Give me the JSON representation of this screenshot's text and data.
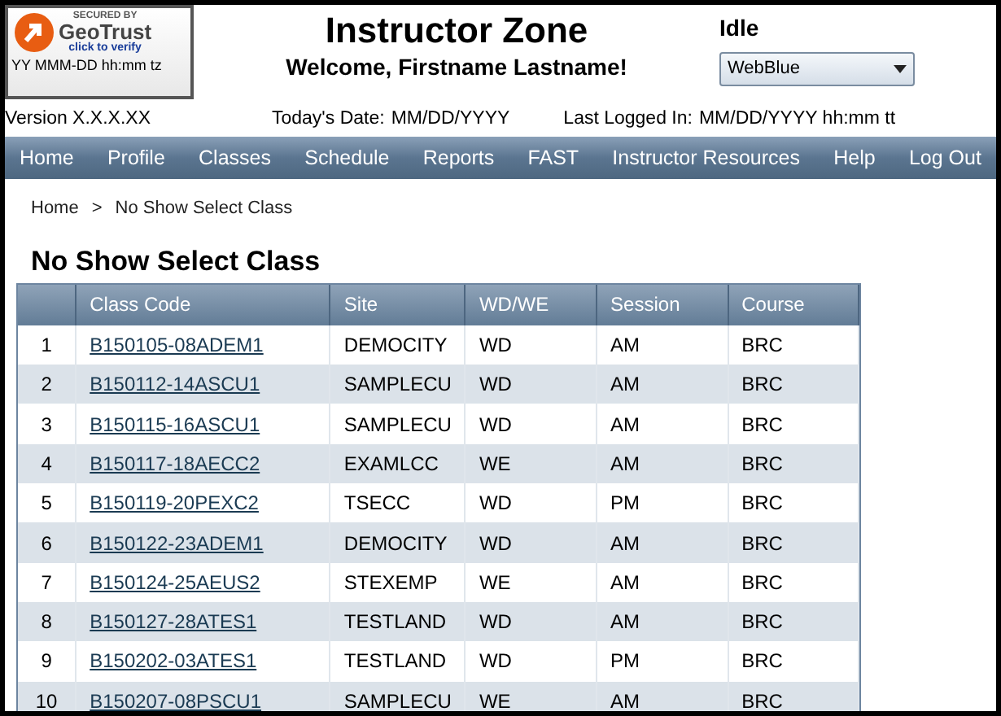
{
  "seal": {
    "secured_by": "SECURED BY",
    "brand": "GeoTrust",
    "verify": "click to verify",
    "timestamp": "YY MMM-DD hh:mm tz"
  },
  "header": {
    "title": "Instructor Zone",
    "welcome": "Welcome, Firstname Lastname!",
    "status": "Idle",
    "theme_select": {
      "value": "WebBlue"
    }
  },
  "info_bar": {
    "version": "Version X.X.X.XX",
    "todays_date_label": "Today's Date:",
    "todays_date": "MM/DD/YYYY",
    "last_logged_label": "Last Logged In:",
    "last_logged": "MM/DD/YYYY hh:mm tt"
  },
  "nav": [
    "Home",
    "Profile",
    "Classes",
    "Schedule",
    "Reports",
    "FAST",
    "Instructor Resources",
    "Help",
    "Log Out"
  ],
  "breadcrumb": {
    "items": [
      "Home",
      "No Show Select Class"
    ],
    "separator": ">"
  },
  "page_title": "No Show Select Class",
  "table": {
    "columns": [
      "Class Code",
      "Site",
      "WD/WE",
      "Session",
      "Course"
    ],
    "rows": [
      {
        "number": "1",
        "class_code": "B150105-08ADEM1",
        "site": "DEMOCITY",
        "wd_we": "WD",
        "session": "AM",
        "course": "BRC"
      },
      {
        "number": "2",
        "class_code": "B150112-14ASCU1",
        "site": "SAMPLECU",
        "wd_we": "WD",
        "session": "AM",
        "course": "BRC"
      },
      {
        "number": "3",
        "class_code": "B150115-16ASCU1",
        "site": "SAMPLECU",
        "wd_we": "WD",
        "session": "AM",
        "course": "BRC"
      },
      {
        "number": "4",
        "class_code": "B150117-18AECC2",
        "site": "EXAMLCC",
        "wd_we": "WE",
        "session": "AM",
        "course": "BRC"
      },
      {
        "number": "5",
        "class_code": "B150119-20PEXC2",
        "site": "TSECC",
        "wd_we": "WD",
        "session": "PM",
        "course": "BRC"
      },
      {
        "number": "6",
        "class_code": "B150122-23ADEM1",
        "site": "DEMOCITY",
        "wd_we": "WD",
        "session": "AM",
        "course": "BRC"
      },
      {
        "number": "7",
        "class_code": "B150124-25AEUS2",
        "site": "STEXEMP",
        "wd_we": "WE",
        "session": "AM",
        "course": "BRC"
      },
      {
        "number": "8",
        "class_code": "B150127-28ATES1",
        "site": "TESTLAND",
        "wd_we": "WD",
        "session": "AM",
        "course": "BRC"
      },
      {
        "number": "9",
        "class_code": "B150202-03ATES1",
        "site": "TESTLAND",
        "wd_we": "WD",
        "session": "PM",
        "course": "BRC"
      },
      {
        "number": "10",
        "class_code": "B150207-08PSCU1",
        "site": "SAMPLECU",
        "wd_we": "WE",
        "session": "AM",
        "course": "BRC"
      }
    ]
  }
}
